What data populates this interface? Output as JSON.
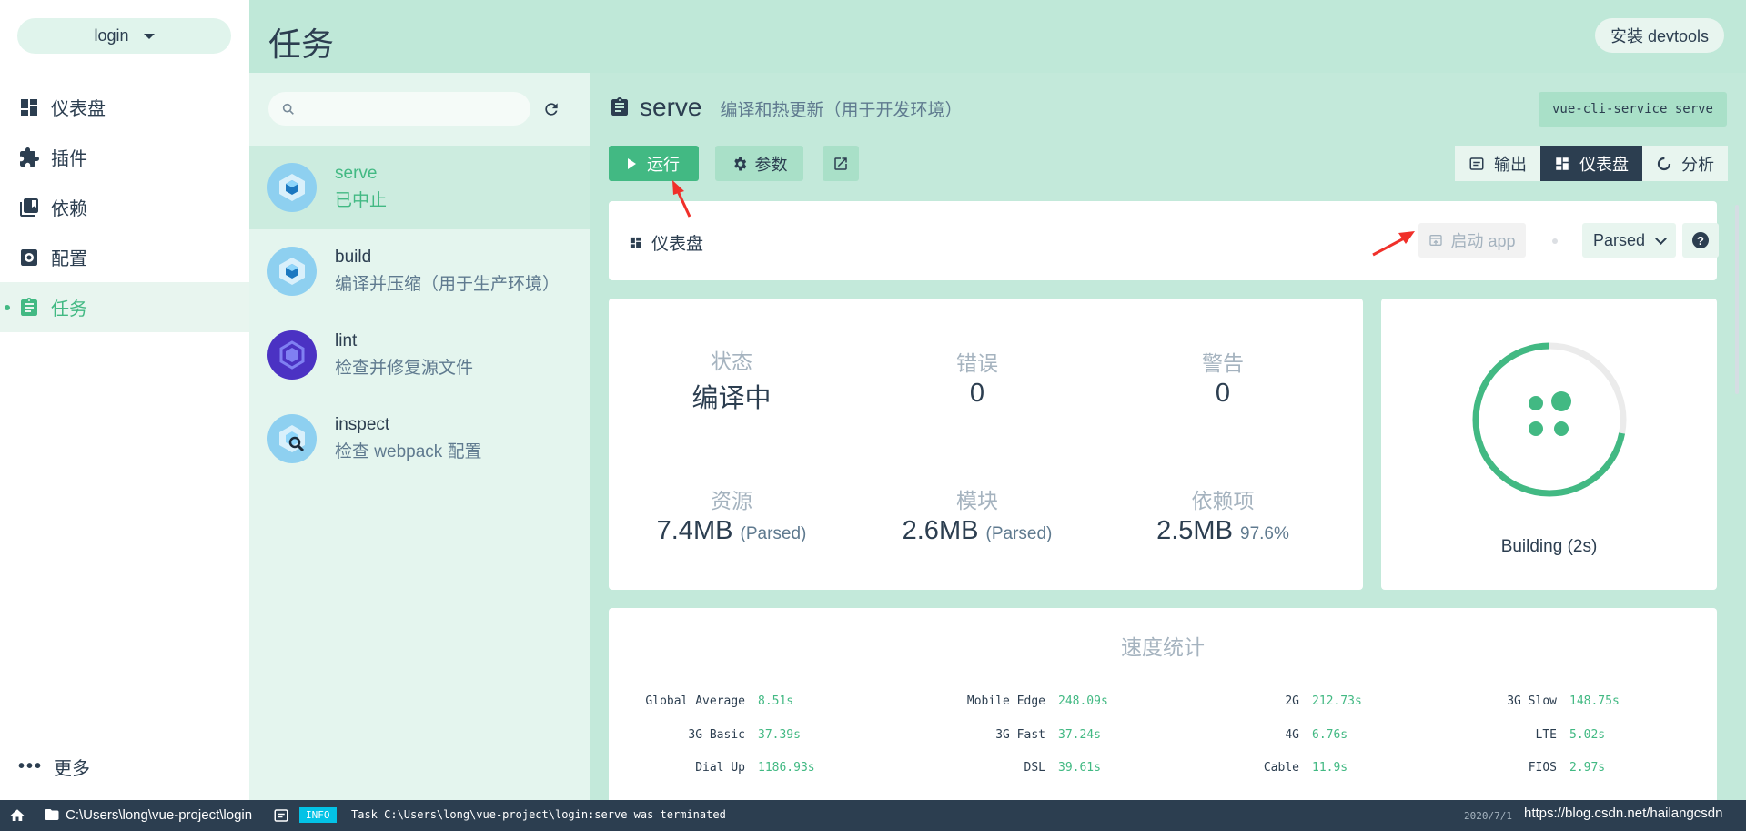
{
  "project": {
    "name": "login"
  },
  "nav": [
    {
      "label": "仪表盘",
      "icon": "dashboard-icon",
      "active": false
    },
    {
      "label": "插件",
      "icon": "puzzle-icon",
      "active": false
    },
    {
      "label": "依赖",
      "icon": "library-icon",
      "active": false
    },
    {
      "label": "配置",
      "icon": "settings-icon",
      "active": false
    },
    {
      "label": "任务",
      "icon": "clipboard-icon",
      "active": true
    }
  ],
  "more_label": "更多",
  "header": {
    "title": "任务",
    "devtools_label": "安装 devtools"
  },
  "search": {
    "placeholder": ""
  },
  "tasks": [
    {
      "name": "serve",
      "desc": "已中止",
      "active": true
    },
    {
      "name": "build",
      "desc": "编译并压缩（用于生产环境）",
      "active": false
    },
    {
      "name": "lint",
      "desc": "检查并修复源文件",
      "active": false
    },
    {
      "name": "inspect",
      "desc": "检查 webpack 配置",
      "active": false
    }
  ],
  "task_detail": {
    "title": "serve",
    "subtitle": "编译和热更新（用于开发环境）",
    "command": "vue-cli-service serve",
    "run_label": "运行",
    "params_label": "参数"
  },
  "views": [
    {
      "label": "输出",
      "icon": "terminal-icon",
      "active": false
    },
    {
      "label": "仪表盘",
      "icon": "dashboard-icon",
      "active": true
    },
    {
      "label": "分析",
      "icon": "donut-icon",
      "active": false
    }
  ],
  "dashboard": {
    "label": "仪表盘",
    "launch_label": "启动 app",
    "mode_selected": "Parsed",
    "help_label": "?"
  },
  "stats": {
    "status": {
      "label": "状态",
      "value": "编译中"
    },
    "errors": {
      "label": "错误",
      "value": "0"
    },
    "warnings": {
      "label": "警告",
      "value": "0"
    },
    "assets": {
      "label": "资源",
      "value": "7.4MB",
      "unit": "(Parsed)"
    },
    "modules": {
      "label": "模块",
      "value": "2.6MB",
      "unit": "(Parsed)"
    },
    "deps": {
      "label": "依赖项",
      "value": "2.5MB",
      "unit": "97.6%"
    }
  },
  "progress": {
    "label": "Building (2s)",
    "fraction": 0.72
  },
  "speed": {
    "title": "速度统计",
    "rows": [
      [
        {
          "label": "Global Average",
          "value": "8.51s"
        },
        {
          "label": "Mobile Edge",
          "value": "248.09s"
        },
        {
          "label": "2G",
          "value": "212.73s"
        },
        {
          "label": "3G Slow",
          "value": "148.75s"
        }
      ],
      [
        {
          "label": "3G Basic",
          "value": "37.39s"
        },
        {
          "label": "3G Fast",
          "value": "37.24s"
        },
        {
          "label": "4G",
          "value": "6.76s"
        },
        {
          "label": "LTE",
          "value": "5.02s"
        }
      ],
      [
        {
          "label": "Dial Up",
          "value": "1186.93s"
        },
        {
          "label": "DSL",
          "value": "39.61s"
        },
        {
          "label": "Cable",
          "value": "11.9s"
        },
        {
          "label": "FIOS",
          "value": "2.97s"
        }
      ]
    ]
  },
  "statusbar": {
    "path": "C:\\Users\\long\\vue-project\\login",
    "badge": "INFO",
    "message": "Task C:\\Users\\long\\vue-project\\login:serve was terminated",
    "time": "2020/7/1",
    "watermark": "https://blog.csdn.net/hailangcsdn"
  },
  "colors": {
    "accent": "#42b983",
    "dark": "#2c3e50",
    "annotation": "#f0302a"
  }
}
